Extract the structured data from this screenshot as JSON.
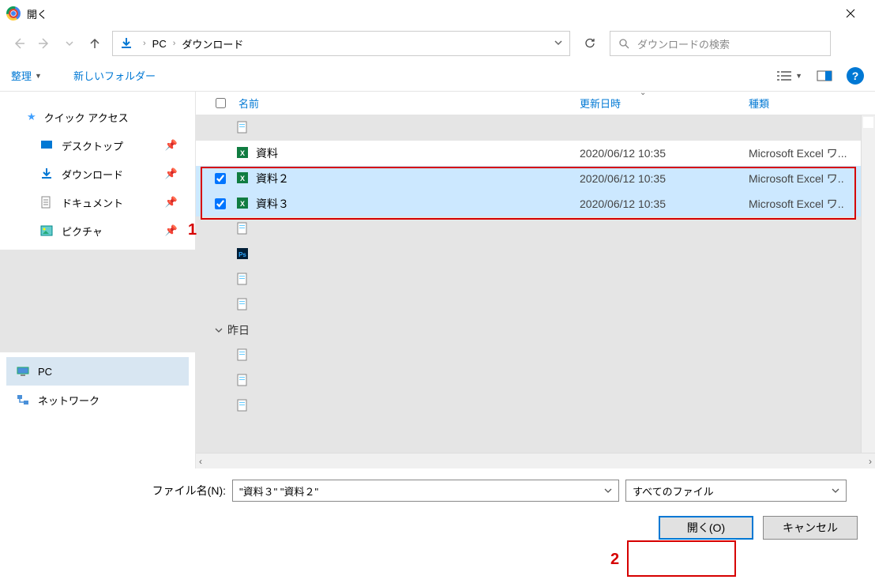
{
  "title": "開く",
  "nav": {
    "crumb1": "PC",
    "crumb2": "ダウンロード"
  },
  "search": {
    "placeholder": "ダウンロードの検索"
  },
  "toolbar": {
    "organize": "整理",
    "new_folder": "新しいフォルダー"
  },
  "sidebar": {
    "quick_access": "クイック アクセス",
    "desktop": "デスクトップ",
    "downloads": "ダウンロード",
    "documents": "ドキュメント",
    "pictures": "ピクチャ",
    "pc": "PC",
    "network": "ネットワーク"
  },
  "columns": {
    "name": "名前",
    "date": "更新日時",
    "type": "種類"
  },
  "files": [
    {
      "name": "",
      "date": "",
      "type": "",
      "icon": "file",
      "checked": false,
      "selected": false,
      "bg": "gray"
    },
    {
      "name": "資料",
      "date": "2020/06/12 10:35",
      "type": "Microsoft Excel ワ...",
      "icon": "excel",
      "checked": false,
      "selected": false,
      "bg": "white"
    },
    {
      "name": "資料２",
      "date": "2020/06/12 10:35",
      "type": "Microsoft Excel ワ..",
      "icon": "excel",
      "checked": true,
      "selected": true,
      "bg": "sel"
    },
    {
      "name": "資料３",
      "date": "2020/06/12 10:35",
      "type": "Microsoft Excel ワ..",
      "icon": "excel",
      "checked": true,
      "selected": true,
      "bg": "sel"
    },
    {
      "name": "",
      "date": "",
      "type": "",
      "icon": "file",
      "checked": false,
      "selected": false,
      "bg": "gray"
    },
    {
      "name": "",
      "date": "",
      "type": "",
      "icon": "ps",
      "checked": false,
      "selected": false,
      "bg": "gray"
    },
    {
      "name": "",
      "date": "",
      "type": "",
      "icon": "file",
      "checked": false,
      "selected": false,
      "bg": "gray"
    },
    {
      "name": "",
      "date": "",
      "type": "",
      "icon": "file",
      "checked": false,
      "selected": false,
      "bg": "gray"
    }
  ],
  "group_label": "昨日",
  "files2": [
    {
      "name": "",
      "date": "",
      "type": "",
      "icon": "file"
    },
    {
      "name": "",
      "date": "",
      "type": "",
      "icon": "file"
    },
    {
      "name": "",
      "date": "",
      "type": "",
      "icon": "file"
    }
  ],
  "footer": {
    "filename_label": "ファイル名(N):",
    "filename_value": "\"資料３\" \"資料２\"",
    "filter_value": "すべてのファイル",
    "open_button": "開く(O)",
    "cancel_button": "キャンセル"
  },
  "annotations": {
    "num1": "1",
    "num2": "2"
  }
}
